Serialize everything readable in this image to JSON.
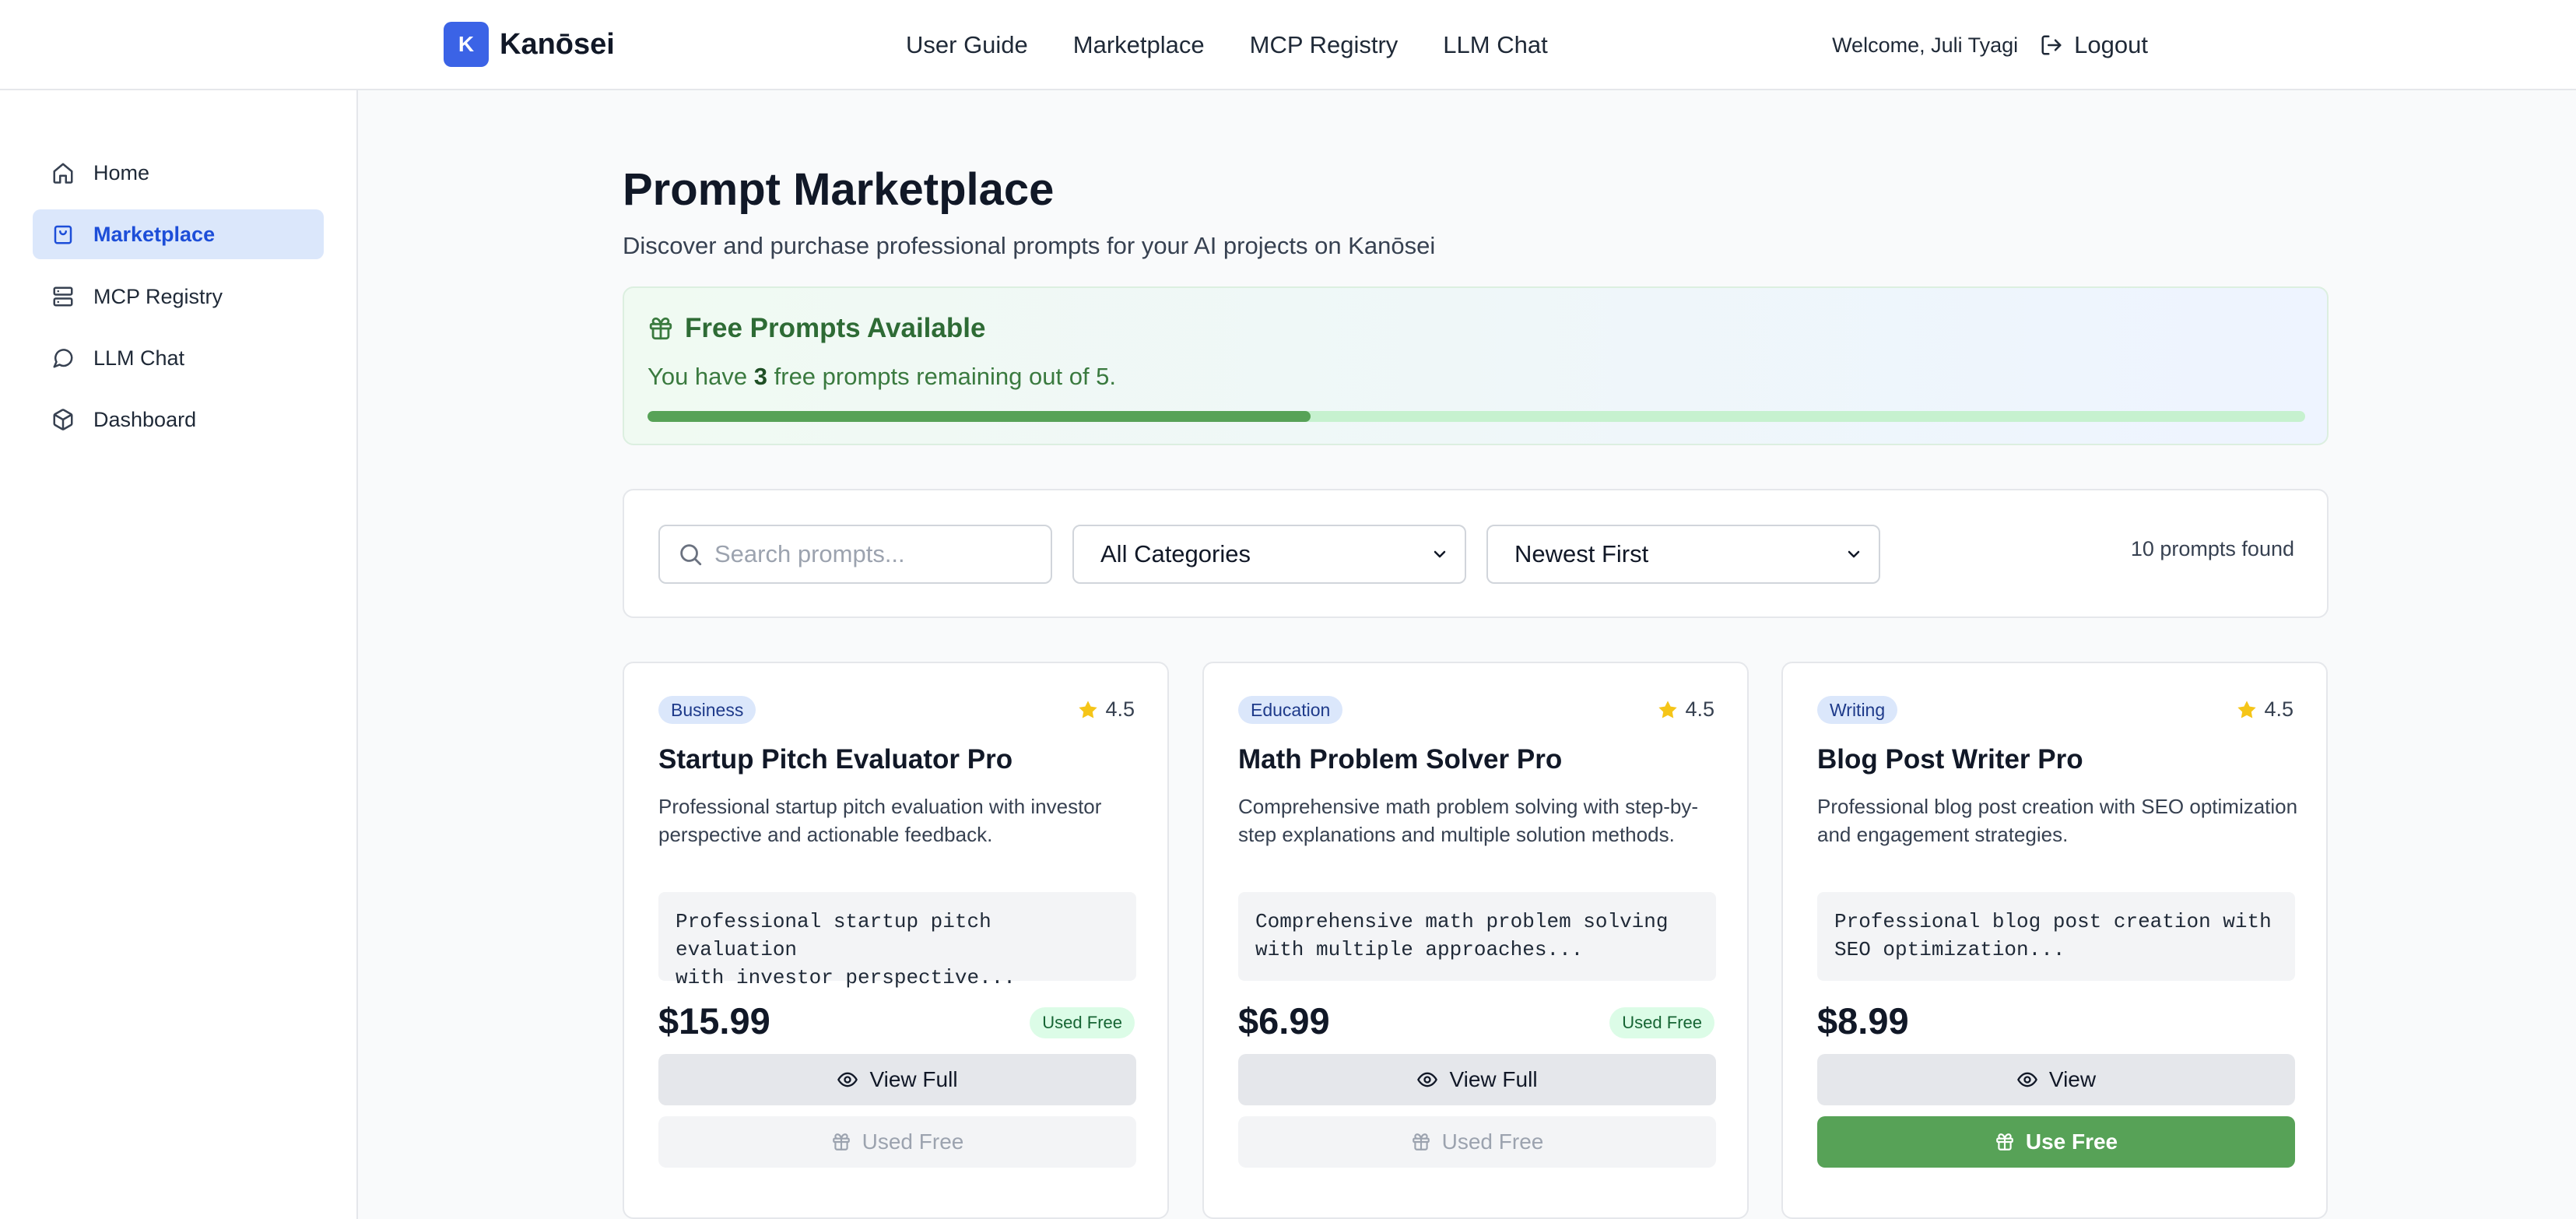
{
  "header": {
    "brand_letter": "K",
    "brand_name": "Kanōsei",
    "nav": [
      "User Guide",
      "Marketplace",
      "MCP Registry",
      "LLM Chat"
    ],
    "welcome": "Welcome, Juli Tyagi",
    "logout": "Logout"
  },
  "sidebar": {
    "items": [
      {
        "label": "Home",
        "icon": "home-icon",
        "active": false
      },
      {
        "label": "Marketplace",
        "icon": "shopping-bag-icon",
        "active": true
      },
      {
        "label": "MCP Registry",
        "icon": "server-icon",
        "active": false
      },
      {
        "label": "LLM Chat",
        "icon": "chat-bubble-icon",
        "active": false
      },
      {
        "label": "Dashboard",
        "icon": "package-icon",
        "active": false
      }
    ]
  },
  "main": {
    "title": "Prompt Marketplace",
    "subtitle": "Discover and purchase professional prompts for your AI projects on Kanōsei"
  },
  "free": {
    "title": "Free Prompts Available",
    "text_before": "You have ",
    "remaining": "3",
    "text_after": " free prompts remaining out of 5.",
    "progress_fraction": 0.4
  },
  "filters": {
    "search_placeholder": "Search prompts...",
    "category": "All Categories",
    "sort": "Newest First",
    "count": "10 prompts found"
  },
  "cards": [
    {
      "category": "Business",
      "rating": "4.5",
      "title": "Startup Pitch Evaluator Pro",
      "description": "Professional startup pitch evaluation with investor perspective and actionable feedback.",
      "code_line1": "Professional startup pitch evaluation",
      "code_line2": "with investor perspective...",
      "price": "$15.99",
      "used_badge": "Used Free",
      "view_label": "View Full",
      "action_label": "Used Free"
    },
    {
      "category": "Education",
      "rating": "4.5",
      "title": "Math Problem Solver Pro",
      "description": "Comprehensive math problem solving with step-by-step explanations and multiple solution methods.",
      "code_line1": "Comprehensive math problem solving",
      "code_line2": "with multiple approaches...",
      "price": "$6.99",
      "used_badge": "Used Free",
      "view_label": "View Full",
      "action_label": "Used Free"
    },
    {
      "category": "Writing",
      "rating": "4.5",
      "title": "Blog Post Writer Pro",
      "description": "Professional blog post creation with SEO optimization and engagement strategies.",
      "code_line1": "Professional blog post creation with",
      "code_line2": "SEO optimization...",
      "price": "$8.99",
      "view_label": "View",
      "action_label": "Use Free"
    }
  ],
  "colors": {
    "brand": "#3b63e6",
    "active_nav_bg": "#dbe7fb",
    "success": "#57a257"
  }
}
